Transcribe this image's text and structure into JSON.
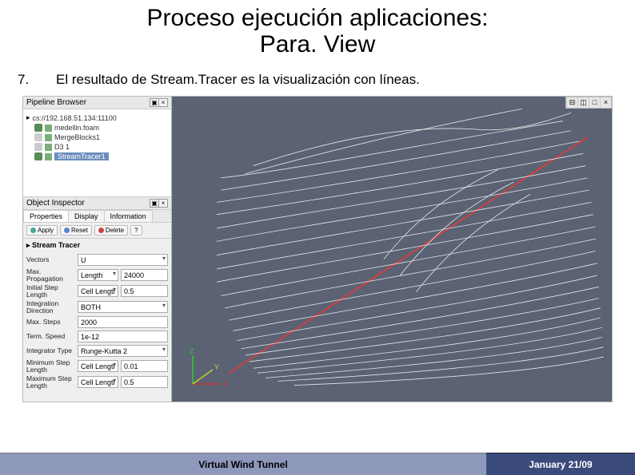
{
  "slide": {
    "title_line1": "Proceso ejecución aplicaciones:",
    "title_line2": "Para. View",
    "step_num": "7.",
    "step_text": "El resultado de Stream.Tracer es la visualización con líneas."
  },
  "pipeline": {
    "panel_title": "Pipeline Browser",
    "root": "cs://192.168.51.134:11100",
    "items": [
      {
        "label": "medellin.foam"
      },
      {
        "label": "MergeBlocks1"
      },
      {
        "label": "D3 1"
      },
      {
        "label": "StreamTracer1",
        "selected": true
      }
    ]
  },
  "inspector": {
    "panel_title": "Object Inspector",
    "tabs": [
      "Properties",
      "Display",
      "Information"
    ],
    "active_tab": 0,
    "buttons": {
      "apply": "Apply",
      "reset": "Reset",
      "delete": "Delete",
      "help": "?"
    },
    "section": "Stream Tracer",
    "fields": {
      "vectors_label": "Vectors",
      "vectors_value": "U",
      "max_prop_label": "Max. Propagation",
      "max_prop_unit": "Length",
      "max_prop_value": "24000",
      "init_step_label": "Initial Step Length",
      "init_step_unit": "Cell Length",
      "init_step_value": "0.5",
      "int_dir_label": "Integration Direction",
      "int_dir_value": "BOTH",
      "max_steps_label": "Max. Steps",
      "max_steps_value": "2000",
      "term_speed_label": "Term. Speed",
      "term_speed_value": "1e-12",
      "integ_type_label": "Integrator Type",
      "integ_type_value": "Runge-Kutta 2",
      "min_step_label": "Minimum Step Length",
      "min_step_unit": "Cell Length",
      "min_step_value": "0.01",
      "max_step_label": "Maximum Step Length",
      "max_step_unit": "Cell Length",
      "max_step_value": "0.5"
    }
  },
  "viewport": {
    "axis_labels": {
      "x": "X",
      "y": "Y",
      "z": "Z"
    }
  },
  "footer": {
    "left": "Virtual Wind Tunnel",
    "right": "January 21/09"
  }
}
